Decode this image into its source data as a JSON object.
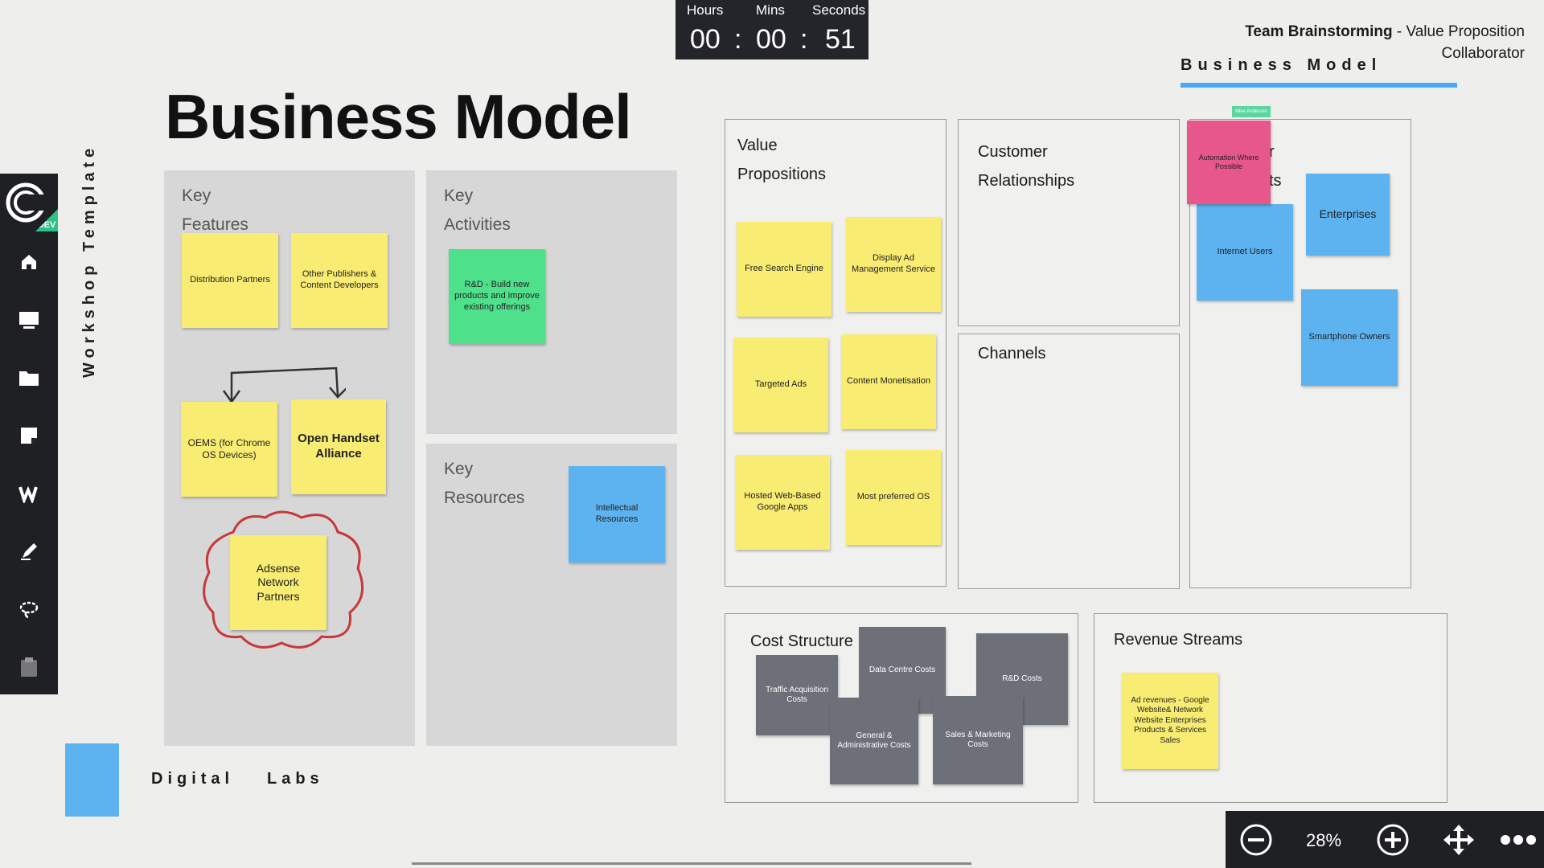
{
  "timer": {
    "hours_label": "Hours",
    "mins_label": "Mins",
    "seconds_label": "Seconds",
    "hours": "00",
    "mins": "00",
    "seconds": "51",
    "sep": ":"
  },
  "header": {
    "team": "Team Brainstorming",
    "dash": " - ",
    "subtitle_line1": "Value Proposition",
    "subtitle_line2": "Collaborator",
    "tab": "Business Model"
  },
  "sidebar": {
    "logo_badge": "DEV",
    "tools": [
      "home-icon",
      "presentation-icon",
      "folder-icon",
      "sticky-note-icon",
      "text-icon",
      "pen-icon",
      "lasso-icon",
      "clipboard-icon"
    ]
  },
  "template_label": "Workshop Template",
  "title": "Business Model",
  "footer_brand": {
    "word1": "Digital",
    "word2": "Labs",
    "color": "#5db2f0"
  },
  "panels": {
    "key_features": {
      "line1": "Key",
      "line2": "Features"
    },
    "key_activities": {
      "line1": "Key",
      "line2": "Activities"
    },
    "key_resources": {
      "line1": "Key",
      "line2": "Resources"
    }
  },
  "boxes": {
    "value_propositions": {
      "line1": "Value",
      "line2": "Propositions"
    },
    "customer_relationships": {
      "line1": "Customer",
      "line2": "Relationships"
    },
    "channels": "Channels",
    "customer_segments_partial": {
      "line1": "r",
      "line2": "ts"
    },
    "cost_structure": "Cost Structure",
    "revenue_streams": "Revenue Streams"
  },
  "notes": {
    "distribution_partners": "Distribution Partners",
    "other_publishers": "Other Publishers & Content Developers",
    "oems": "OEMS (for Chrome OS Devices)",
    "open_handset": "Open Handset Alliance",
    "adsense": "Adsense Network Partners",
    "rnd_build": "R&D - Build new products and improve existing offerings",
    "intellectual_resources": "Intellectual Resources",
    "free_search": "Free Search Engine",
    "display_ad": "Display Ad Management Service",
    "targeted_ads": "Targeted Ads",
    "content_monetisation": "Content Monetisation",
    "hosted_web": "Hosted Web-Based Google Apps",
    "most_preferred": "Most preferred OS",
    "automation": "Automation Where Possible",
    "automation_tag": "Mike Anderson",
    "internet_users": "Internet Users",
    "enterprises": "Enterprises",
    "smartphone_owners": "Smartphone Owners",
    "traffic_acq": "Traffic Acquisition Costs",
    "data_centre": "Data Centre Costs",
    "rnd_costs": "R&D Costs",
    "gen_admin": "General & Administrative Costs",
    "sales_marketing": "Sales & Marketing Costs",
    "ad_revenues": "Ad revenues - Google Website& Network Website Enterprises Products & Services Sales"
  },
  "zoom": {
    "level": "28%"
  },
  "colors": {
    "accent": "#4aa8f2",
    "toolbar": "#1f2024",
    "dev_badge": "#2ec28b"
  }
}
